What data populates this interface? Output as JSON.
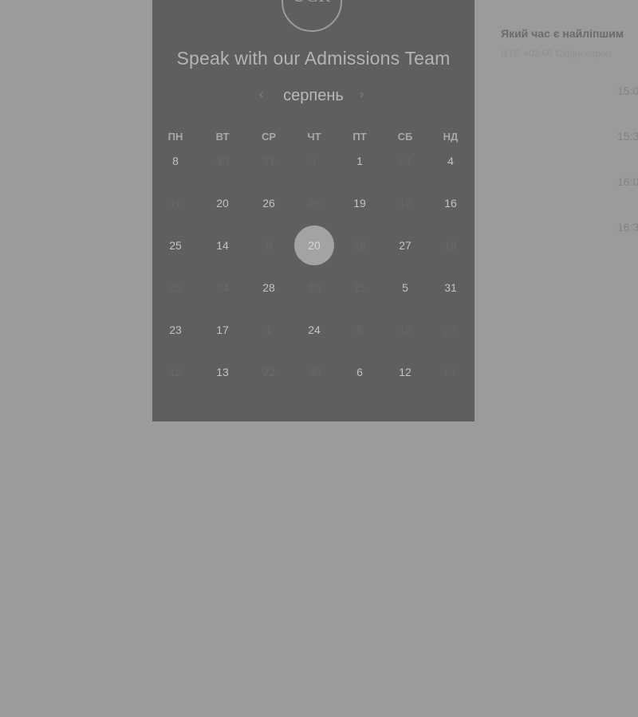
{
  "panel": {
    "logo_text": "UCR",
    "title": "Speak with our Admissions Team",
    "month": "серпень",
    "prev_icon": "‹",
    "next_icon": "›",
    "weekdays": [
      "ПН",
      "ВТ",
      "СР",
      "ЧТ",
      "ПТ",
      "СБ",
      "НД"
    ],
    "weeks": [
      [
        {
          "d": "8",
          "a": true
        },
        {
          "d": "30",
          "a": false
        },
        {
          "d": "31",
          "a": false
        },
        {
          "d": "1",
          "a": false
        },
        {
          "d": "1",
          "a": true
        },
        {
          "d": "24",
          "a": false
        },
        {
          "d": "4",
          "a": true
        }
      ],
      [
        {
          "d": "11",
          "a": false
        },
        {
          "d": "20",
          "a": true
        },
        {
          "d": "26",
          "a": true
        },
        {
          "d": "29",
          "a": false
        },
        {
          "d": "19",
          "a": true
        },
        {
          "d": "15",
          "a": false
        },
        {
          "d": "16",
          "a": true
        }
      ],
      [
        {
          "d": "25",
          "a": true
        },
        {
          "d": "14",
          "a": true
        },
        {
          "d": "5",
          "a": false
        },
        {
          "d": "20",
          "a": true,
          "selected": true
        },
        {
          "d": "20",
          "a": false
        },
        {
          "d": "27",
          "a": true
        },
        {
          "d": "18",
          "a": false
        }
      ],
      [
        {
          "d": "23",
          "a": false
        },
        {
          "d": "24",
          "a": false
        },
        {
          "d": "28",
          "a": true
        },
        {
          "d": "10",
          "a": false
        },
        {
          "d": "11",
          "a": false
        },
        {
          "d": "5",
          "a": true
        },
        {
          "d": "31",
          "a": true
        }
      ],
      [
        {
          "d": "23",
          "a": true
        },
        {
          "d": "17",
          "a": true
        },
        {
          "d": "1",
          "a": false
        },
        {
          "d": "24",
          "a": true
        },
        {
          "d": "8",
          "a": false
        },
        {
          "d": "16",
          "a": false
        },
        {
          "d": "27",
          "a": false
        }
      ],
      [
        {
          "d": "12",
          "a": false
        },
        {
          "d": "13",
          "a": true
        },
        {
          "d": "22",
          "a": false
        },
        {
          "d": "30",
          "a": false
        },
        {
          "d": "6",
          "a": true
        },
        {
          "d": "12",
          "a": true
        },
        {
          "d": "21",
          "a": false
        }
      ]
    ]
  },
  "side": {
    "question": "Який час є найліпшим",
    "timezone": "UTC +03:00 Східноєвроп",
    "slots": [
      "15:0",
      "15:3",
      "16:0",
      "16:3"
    ]
  },
  "colors": {
    "page_bg": "#9b9b9b",
    "panel_bg": "#5f5f5f",
    "selected_day": "#a3a3a3"
  }
}
